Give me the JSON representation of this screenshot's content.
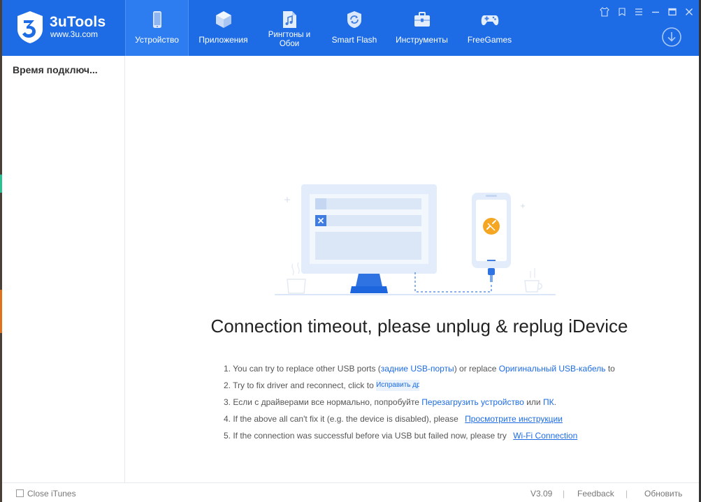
{
  "app": {
    "name": "3uTools",
    "site": "www.3u.com"
  },
  "nav": {
    "items": [
      {
        "label": "Устройство",
        "icon": "phone-icon"
      },
      {
        "label": "Приложения",
        "icon": "cube-icon"
      },
      {
        "label": "Рингтоны и Обои",
        "icon": "music-file-icon"
      },
      {
        "label": "Smart Flash",
        "icon": "refresh-shield-icon"
      },
      {
        "label": "Инструменты",
        "icon": "toolbox-icon"
      },
      {
        "label": "FreeGames",
        "icon": "gamepad-icon"
      }
    ],
    "active": "Устройство"
  },
  "window_controls": [
    "shirt-icon",
    "tag-icon",
    "menu-icon",
    "minimize-icon",
    "maximize-icon",
    "close-icon"
  ],
  "sidebar": {
    "title": "Время подключ..."
  },
  "main": {
    "headline": "Connection timeout, please unplug & replug iDevice",
    "tips": {
      "t1": {
        "pre": "1. You can try to replace other USB ports (",
        "link1": "задние USB-порты",
        "mid": ") or replace ",
        "link2": "Оригинальный USB-кабель",
        "post": " to r"
      },
      "t2": {
        "pre": "2. Try to fix driver and reconnect, click to ",
        "button": "Исправить драй"
      },
      "t3": {
        "pre": "3. Если с драйверами все нормально, попробуйте ",
        "link1": "Перезагрузить устройство",
        "mid": " или ",
        "link2": "ПК",
        "post": "."
      },
      "t4": {
        "pre": "4. If the above all can't fix it (e.g. the device is disabled), please ",
        "link": "Просмотрите инструкции"
      },
      "t5": {
        "pre": "5. If the connection was successful before via USB but failed now, please try ",
        "link": "Wi-Fi Connection"
      }
    }
  },
  "footer": {
    "close_itunes": "Close iTunes",
    "version": "V3.09",
    "separator": "|",
    "feedback": "Feedback",
    "update": "Обновить"
  },
  "colors": {
    "header": "#1d6ce6",
    "nav_active": "#2d7cf0",
    "link": "#1d6ce6",
    "badge_orange": "#f5a623"
  }
}
